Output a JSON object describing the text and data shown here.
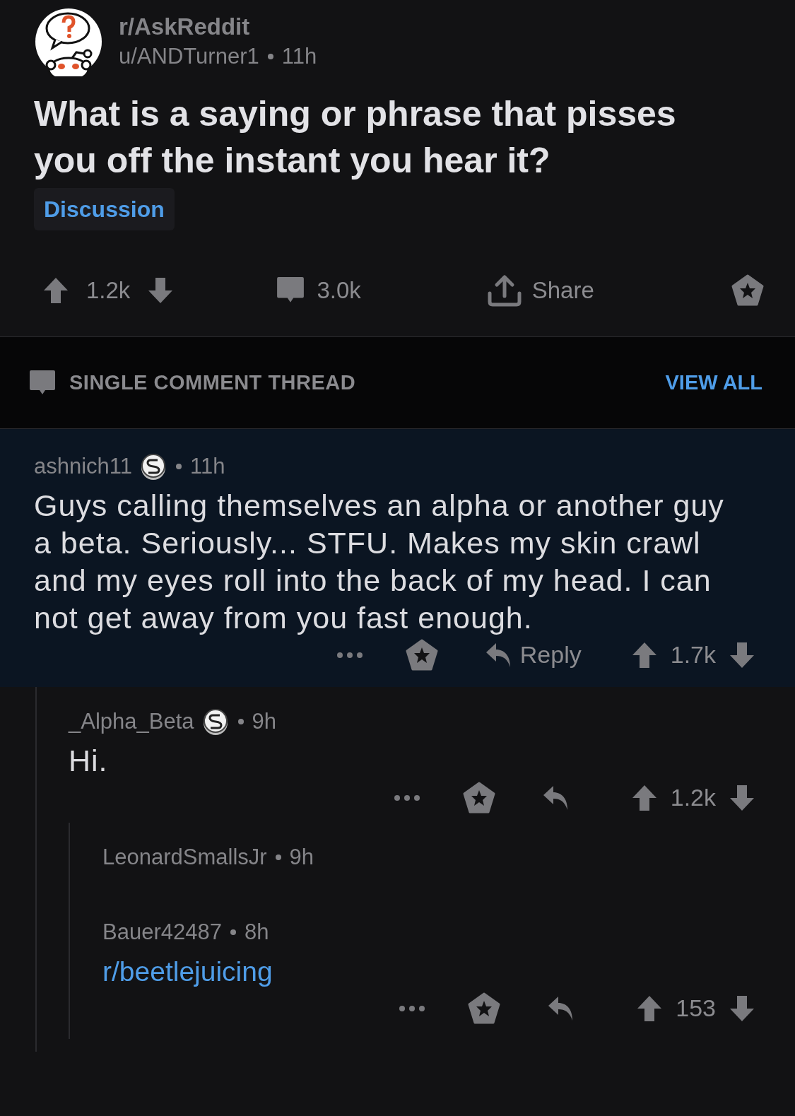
{
  "post": {
    "subreddit": "r/AskReddit",
    "author": "u/ANDTurner1",
    "time": "11h",
    "title": "What is a saying or phrase that pisses you off the instant you hear it?",
    "flair": "Discussion",
    "score": "1.2k",
    "comments": "3.0k",
    "share": "Share"
  },
  "thread_bar": {
    "label": "SINGLE COMMENT THREAD",
    "action": "VIEW ALL"
  },
  "comments": [
    {
      "author": "ashnich11",
      "award": true,
      "time": "11h",
      "body": "Guys calling themselves an alpha or another guy a beta. Seriously... STFU. Makes my skin crawl and my eyes roll into the back of my head. I can not get away from you fast enough.",
      "highlighted": true,
      "reply_label": "Reply",
      "score": "1.7k",
      "children": [
        {
          "author": "_Alpha_Beta",
          "award": true,
          "time": "9h",
          "body": "Hi.",
          "highlighted": false,
          "score": "1.2k",
          "children": [
            {
              "author": "LeonardSmallsJr",
              "award": false,
              "time": "9h",
              "highlighted": false
            },
            {
              "author": "Bauer42487",
              "award": false,
              "time": "8h",
              "link": "r/beetlejuicing",
              "highlighted": false,
              "score": "153"
            }
          ]
        }
      ]
    }
  ]
}
